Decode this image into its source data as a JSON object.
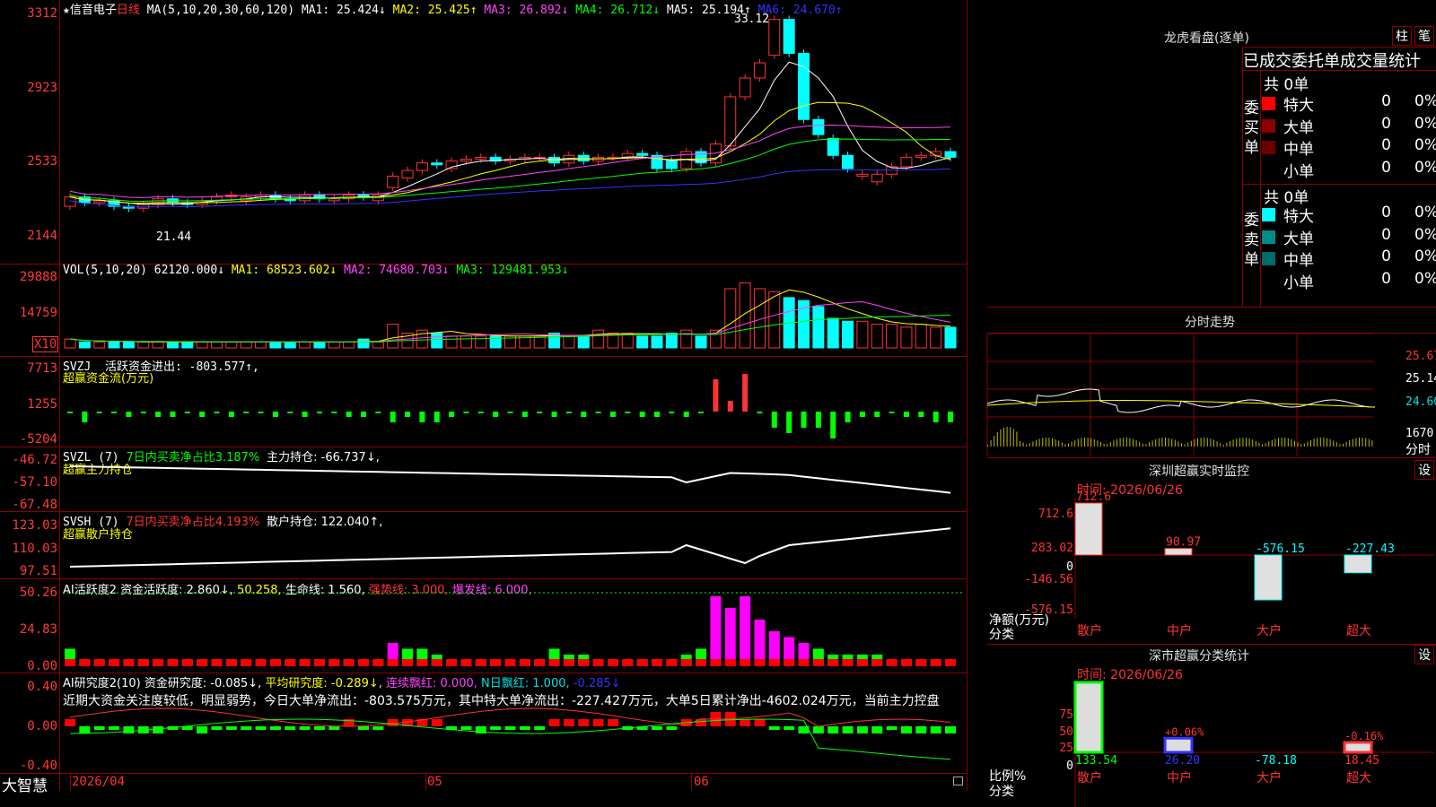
{
  "stock": {
    "star": "★",
    "name": "信音电子",
    "period": "日线"
  },
  "ma_header": {
    "params": "MA(5,10,20,30,60,120)",
    "ma1": "MA1: 25.424↓",
    "ma2": "MA2: 25.425↑",
    "ma3": "MA3: 26.892↓",
    "ma4": "MA4: 26.712↓",
    "ma5": "MA5: 25.194↑",
    "ma6": "MA6: 24.670↑"
  },
  "price_axis": [
    "3312",
    "2923",
    "2533",
    "2144"
  ],
  "price_annotations": {
    "high": "33.12",
    "low": "21.44"
  },
  "vol_header": {
    "params": "VOL(5,10,20)",
    "value": "62120.000↓",
    "ma1": "MA1: 68523.602↓",
    "ma2": "MA2: 74680.703↓",
    "ma3": "MA3: 129481.953↓"
  },
  "vol_axis": [
    "29888",
    "14759"
  ],
  "vol_unit": "X10",
  "svzj": {
    "title": "SVZJ",
    "label": "活跃资金进出: -803.577↑,",
    "subtitle": "超赢资金流(万元)",
    "axis": [
      "7713",
      "1255",
      "-5204"
    ]
  },
  "svzl": {
    "title": "SVZL (7)",
    "ratio": "7日内买卖净占比3.187%",
    "label": "主力持仓: -66.737↓,",
    "subtitle": "超赢主力持仓",
    "axis": [
      "-46.72",
      "-57.10",
      "-67.48"
    ]
  },
  "svsh": {
    "title": "SVSH (7)",
    "ratio": "7日内买卖净占比4.193%",
    "label": "散户持仓: 122.040↑,",
    "subtitle": "超赢散户持仓",
    "axis": [
      "123.03",
      "110.03",
      "97.51"
    ]
  },
  "ai_active": {
    "title": "AI活跃度2",
    "a": "资金活跃度: 2.860↓,",
    "b": "50.258,",
    "c": "生命线: 1.560,",
    "d": "强势线: 3.000,",
    "e": "爆发线: 6.000,",
    "axis": [
      "50.26",
      "24.83",
      "0.00"
    ]
  },
  "ai_research": {
    "title": "AI研究度2(10)",
    "a": "资金研究度: -0.085↓,",
    "b": "平均研究度: -0.289↓,",
    "c": "连续飘红: 0.000,",
    "d": "N日飘红: 1.000,",
    "e": "-0.285↓",
    "text": "近期大资金关注度较低，明显弱势，今日大单净流出：-803.575万元，其中特大单净流出：-227.427万元，大单5日累计净出-4602.024万元，当前主力控盘",
    "axis": [
      "0.40",
      "0.00",
      "-0.40"
    ]
  },
  "date_axis": {
    "start": "2026/04",
    "m1": "05",
    "m2": "06"
  },
  "brand": "大智慧",
  "longhu": {
    "title": "龙虎看盘(逐单)",
    "btn1": "柱",
    "btn2": "笔",
    "subtitle": "已成交委托单成交量统计",
    "buy_label": "委买单",
    "sell_label": "委卖单",
    "buy_total": "共 0单",
    "sell_total": "共 0单",
    "buy_rows": [
      {
        "label": "特大",
        "num": "0",
        "pct": "0%",
        "color": "#ff0000"
      },
      {
        "label": "大单",
        "num": "0",
        "pct": "0%",
        "color": "#8b0000"
      },
      {
        "label": "中单",
        "num": "0",
        "pct": "0%",
        "color": "#6b0000"
      },
      {
        "label": "小单",
        "num": "0",
        "pct": "0%",
        "color": "#000000"
      }
    ],
    "sell_rows": [
      {
        "label": "特大",
        "num": "0",
        "pct": "0%",
        "color": "#00ffff"
      },
      {
        "label": "大单",
        "num": "0",
        "pct": "0%",
        "color": "#008b8b"
      },
      {
        "label": "中单",
        "num": "0",
        "pct": "0%",
        "color": "#006b6b"
      },
      {
        "label": "小单",
        "num": "0",
        "pct": "0%",
        "color": "#000000"
      }
    ]
  },
  "fenshi": {
    "title": "分时走势",
    "axis": [
      "25.67",
      "25.14",
      "24.60"
    ],
    "vol_label": "1670",
    "bottom_label": "分时"
  },
  "sz_monitor": {
    "title": "深圳超赢实时监控",
    "btn": "设",
    "time": "时间: 2026/06/26",
    "axis": [
      "712.6",
      "283.02",
      "0",
      "-146.56",
      "-576.15"
    ],
    "axis_title": "净额(万元)",
    "cat_title": "分类",
    "chart_data": {
      "type": "bar",
      "categories": [
        "散户",
        "中户",
        "大户",
        "超大"
      ],
      "values": [
        712.6,
        90.97,
        -576.15,
        -227.43
      ],
      "labels": [
        "712.6",
        "90.97",
        "-576.15",
        "-227.43"
      ],
      "ylim": [
        -576.15,
        712.6
      ]
    }
  },
  "sz_class": {
    "title": "深市超赢分类统计",
    "btn": "设",
    "time": "时间: 2026/06/26",
    "axis": [
      "75",
      "50",
      "25",
      "0"
    ],
    "axis_title": "比例%",
    "cat_title": "分类",
    "chart_data": {
      "type": "bar",
      "categories": [
        "散户",
        "中户",
        "大户",
        "超大"
      ],
      "values": [
        133.54,
        26.2,
        -78.18,
        18.45
      ],
      "labels": [
        "133.54",
        "26.20",
        "-78.18",
        "18.45"
      ],
      "pct_labels": [
        "",
        "+0.06%",
        "",
        "-0.16%"
      ]
    }
  },
  "colors": {
    "up": "#ff3333",
    "down": "#00ffff",
    "axis": "#8b0000",
    "ma_white": "#ffffff",
    "ma_yellow": "#ffff00",
    "ma_magenta": "#ff44ff",
    "ma_green": "#00ff00"
  }
}
